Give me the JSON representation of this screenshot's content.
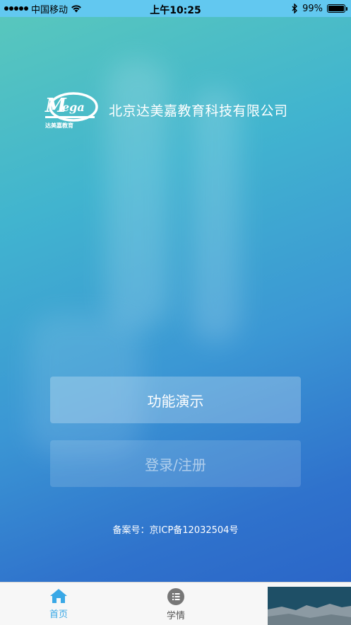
{
  "status_bar": {
    "carrier": "中国移动",
    "time": "上午10:25",
    "battery": "99%",
    "battery_level": 0.99,
    "icons": [
      "signal-dots-icon",
      "wifi-icon",
      "bluetooth-icon",
      "battery-icon"
    ]
  },
  "brand": {
    "logo_text": "Mega",
    "logo_caption": "达美嘉教育",
    "company_name": "北京达美嘉教育科技有限公司"
  },
  "buttons": {
    "demo_label": "功能演示",
    "login_label": "登录/注册"
  },
  "footer": {
    "icp": "备案号：京ICP备12032504号"
  },
  "tabbar": {
    "tabs": [
      {
        "label": "首页",
        "icon": "home-icon",
        "active": true
      },
      {
        "label": "学情",
        "icon": "list-icon",
        "active": false
      }
    ]
  },
  "colors": {
    "status_bar": "#62c8f0",
    "gradient_top": "#58c7bd",
    "gradient_bottom": "#2b66c8",
    "tab_active": "#39a8e6"
  }
}
